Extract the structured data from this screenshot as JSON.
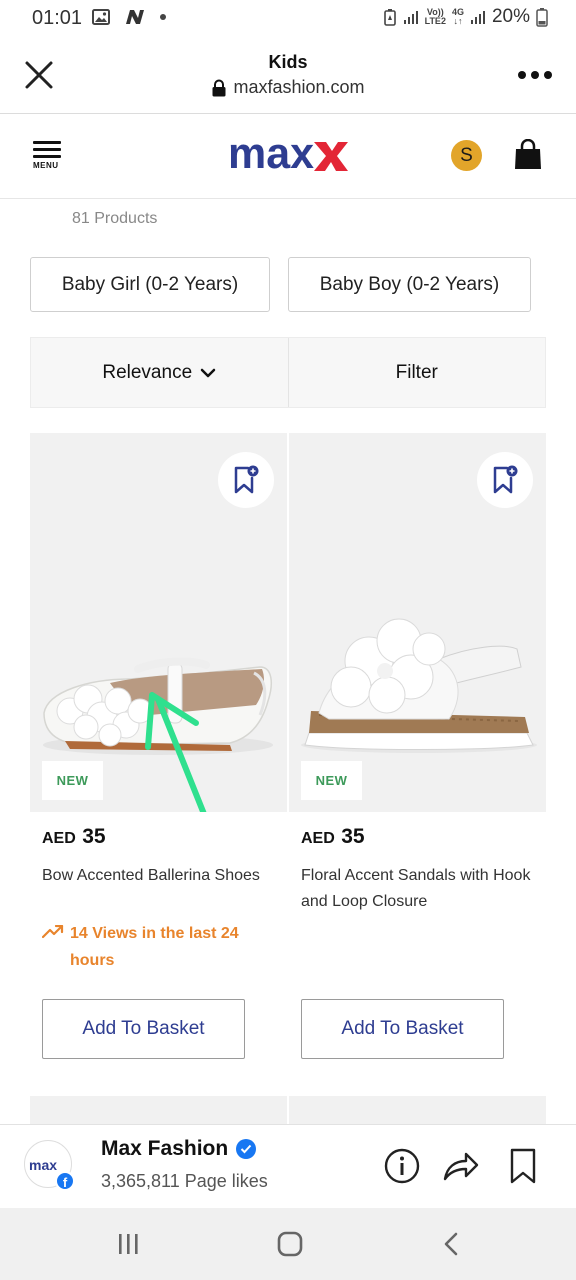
{
  "status_bar": {
    "time": "01:01",
    "network_top": "Vo))",
    "network_bottom": "LTE2",
    "network_type": "4G",
    "battery": "20%"
  },
  "browser": {
    "page_title": "Kids",
    "url": "maxfashion.com"
  },
  "site_header": {
    "menu_label": "MENU",
    "logo_text": "max",
    "coin_label": "S"
  },
  "listing": {
    "product_count": "81 Products",
    "categories": [
      "Baby Girl (0-2 Years)",
      "Baby Boy (0-2 Years)"
    ],
    "sort_label": "Relevance",
    "filter_label": "Filter"
  },
  "products": [
    {
      "badge": "NEW",
      "currency": "AED",
      "price": "35",
      "name": "Bow Accented Ballerina Shoes",
      "views": "14 Views in the last 24 hours",
      "cta": "Add To Basket"
    },
    {
      "badge": "NEW",
      "currency": "AED",
      "price": "35",
      "name": "Floral Accent Sandals with Hook and Loop Closure",
      "cta": "Add To Basket"
    }
  ],
  "fb_bar": {
    "avatar_text": "max",
    "page_name": "Max Fashion",
    "likes": "3,365,811 Page likes"
  },
  "colors": {
    "brand_blue": "#2e3d91",
    "brand_red": "#e32636",
    "views_orange": "#e8842c",
    "new_green": "#3d9a5a",
    "coin_gold": "#e2a52a",
    "annotation_arrow": "#2fe08e"
  }
}
